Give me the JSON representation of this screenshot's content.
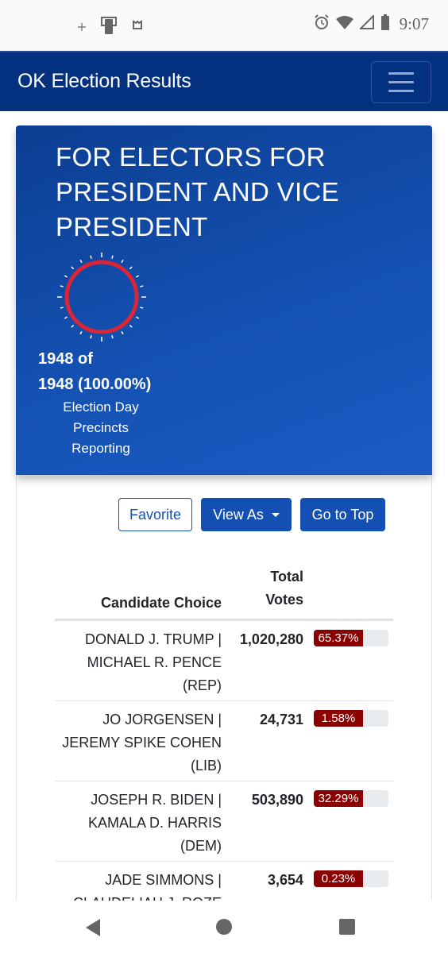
{
  "status_bar": {
    "time": "9:07",
    "left_icons": [
      "sparkle-icon",
      "screen-cast-icon",
      "shield-app-icon"
    ],
    "right_icons": [
      "alarm-icon",
      "wifi-icon",
      "signal-icon",
      "battery-icon"
    ]
  },
  "navbar": {
    "brand": "OK Election Results",
    "menu_icon": "hamburger-icon"
  },
  "race": {
    "title": "FOR ELECTORS FOR PRESIDENT AND VICE PRESIDENT",
    "precincts_reported": 1948,
    "precincts_total": 1948,
    "precincts_line1": "1948 of",
    "precincts_line2": "1948 (100.00%)",
    "precincts_label_lines": [
      "Election Day",
      "Precincts",
      "Reporting"
    ],
    "reporting_fraction": 1.0,
    "gauge_color": "#dc2535"
  },
  "actions": {
    "favorite": "Favorite",
    "view_as": "View As",
    "go_to_top": "Go to Top"
  },
  "table": {
    "headers": {
      "candidate": "Candidate Choice",
      "votes_line1": "Total",
      "votes_line2": "Votes"
    },
    "bar_color": "#8b0000",
    "rows": [
      {
        "lines": [
          "DONALD J. TRUMP |",
          "MICHAEL R. PENCE",
          "(REP)"
        ],
        "votes": "1,020,280",
        "percent": "65.37%",
        "percent_value": 65.37
      },
      {
        "lines": [
          "JO JORGENSEN |",
          "JEREMY SPIKE COHEN",
          "(LIB)"
        ],
        "votes": "24,731",
        "percent": "1.58%",
        "percent_value": 1.58
      },
      {
        "lines": [
          "JOSEPH R. BIDEN |",
          "KAMALA D. HARRIS",
          "(DEM)"
        ],
        "votes": "503,890",
        "percent": "32.29%",
        "percent_value": 32.29
      },
      {
        "lines": [
          "JADE SIMMONS |",
          "CLAUDELIAH J. ROZE",
          ""
        ],
        "votes": "3,654",
        "percent": "0.23%",
        "percent_value": 0.23
      }
    ]
  },
  "android_nav": {
    "back": "back-icon",
    "home": "home-icon",
    "recents": "recents-icon"
  }
}
